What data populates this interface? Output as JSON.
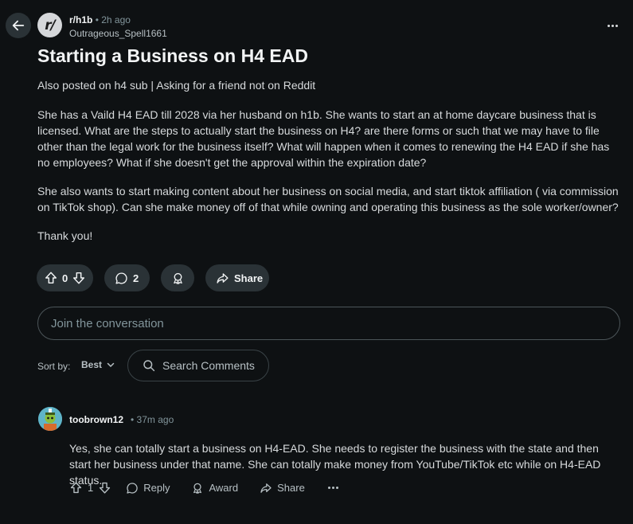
{
  "post": {
    "subreddit": "r/h1b",
    "subreddit_avatar_text": "r/",
    "separator": "•",
    "time": "2h ago",
    "author": "Outrageous_Spell1661",
    "title": "Starting a Business on H4 EAD",
    "body": [
      "Also posted on h4 sub | Asking for a friend not on Reddit",
      "She has a Vaild H4 EAD till 2028 via her husband on h1b. She wants to start an at home daycare business that is licensed. What are the steps to actually start the business on H4? are there forms or such that we may have to file other than the legal work for the business itself? What will happen when it comes to renewing the H4 EAD if she has no employees? What if she doesn't get the approval within the expiration date?",
      "She also wants to start making content about her business on social media, and start tiktok affiliation ( via commission on TikTok shop). Can she make money off of that while owning and operating this business as the sole worker/owner?",
      "Thank you!"
    ],
    "vote_count": "0",
    "comment_count": "2",
    "share_label": "Share"
  },
  "composer": {
    "placeholder": "Join the conversation"
  },
  "sort": {
    "label": "Sort by:",
    "value": "Best"
  },
  "search_comments": {
    "placeholder": "Search Comments"
  },
  "comment": {
    "author": "toobrown12",
    "separator": "•",
    "time": "37m ago",
    "body": "Yes, she can totally start a business on H4-EAD. She needs to register the business with the state and then start her business under that name. She can totally make money from YouTube/TikTok etc while on H4-EAD status.",
    "vote_count": "1",
    "reply_label": "Reply",
    "award_label": "Award",
    "share_label": "Share"
  },
  "icons": [
    "back-arrow-icon",
    "more-icon",
    "upvote-icon",
    "downvote-icon",
    "comment-icon",
    "award-icon",
    "share-icon",
    "search-icon",
    "chevron-down-icon"
  ],
  "colors": {
    "background": "#0e1113",
    "pill": "#2a3236",
    "text": "#d7dadc",
    "muted": "#82959b"
  }
}
